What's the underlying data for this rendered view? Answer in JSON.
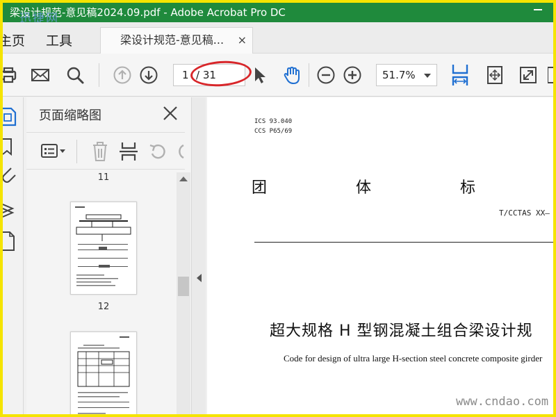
{
  "window": {
    "title": "梁设计规范-意见稿2024.09.pdf - Adobe Acrobat Pro DC",
    "watermark_top": "迅捷网"
  },
  "menu": {
    "home": "主页",
    "tools": "工具"
  },
  "tab": {
    "label": "梁设计规范-意见稿...",
    "close": "×"
  },
  "toolbar": {
    "page_current": "1",
    "page_total": "/ 31",
    "zoom": "51.7%",
    "icons": [
      "print-icon",
      "mail-icon",
      "search-icon",
      "prev-page-icon",
      "next-page-icon",
      "select-cursor-icon",
      "hand-tool-icon",
      "zoom-out-icon",
      "zoom-in-icon",
      "fit-width-icon",
      "scroll-mode-icon",
      "fullscreen-icon"
    ]
  },
  "thumbnails": {
    "title": "页面缩略图",
    "page_numbers": [
      "11",
      "12"
    ]
  },
  "document": {
    "ics_line": "ICS  93.040",
    "ccs_line": "CCS  P65/69",
    "std_chars": [
      "团",
      "体",
      "标"
    ],
    "std_code": "T/CCTAS XX—",
    "title_cn": "超大规格 H 型钢混凝土组合梁设计规",
    "title_en": "Code for design of ultra large H-section steel concrete composite girder",
    "watermark_bottom": "www.cndao.com"
  },
  "colors": {
    "titlebar": "#1f8a3c",
    "border": "#f5e400",
    "accent_blue": "#1f6fd1",
    "annotation_red": "#d8262a"
  }
}
